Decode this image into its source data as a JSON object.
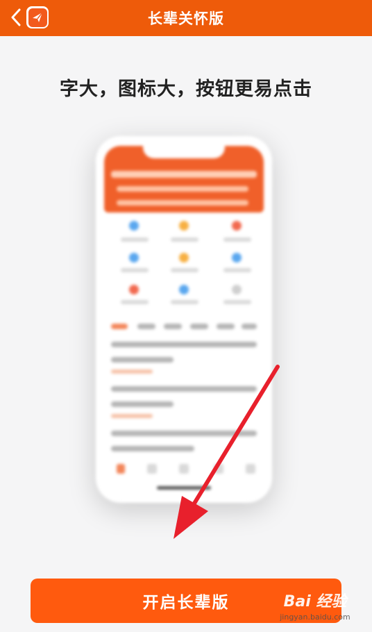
{
  "header": {
    "title": "长辈关怀版",
    "back_icon": "chevron-left-icon",
    "logo_icon": "app-logo-icon",
    "bg_color": "#ee5b0a"
  },
  "main": {
    "headline": "字大，图标大，按钮更易点击",
    "preview_image": "phone-preview-elder-mode"
  },
  "action": {
    "primary_label": "开启长辈版",
    "button_color": "#ff5a0e"
  },
  "annotation": {
    "arrow_color": "#e8202c",
    "arrow_target": "primary-button"
  },
  "watermark": {
    "brand": "Bai 经验",
    "url": "jingyan.baidu.com"
  }
}
